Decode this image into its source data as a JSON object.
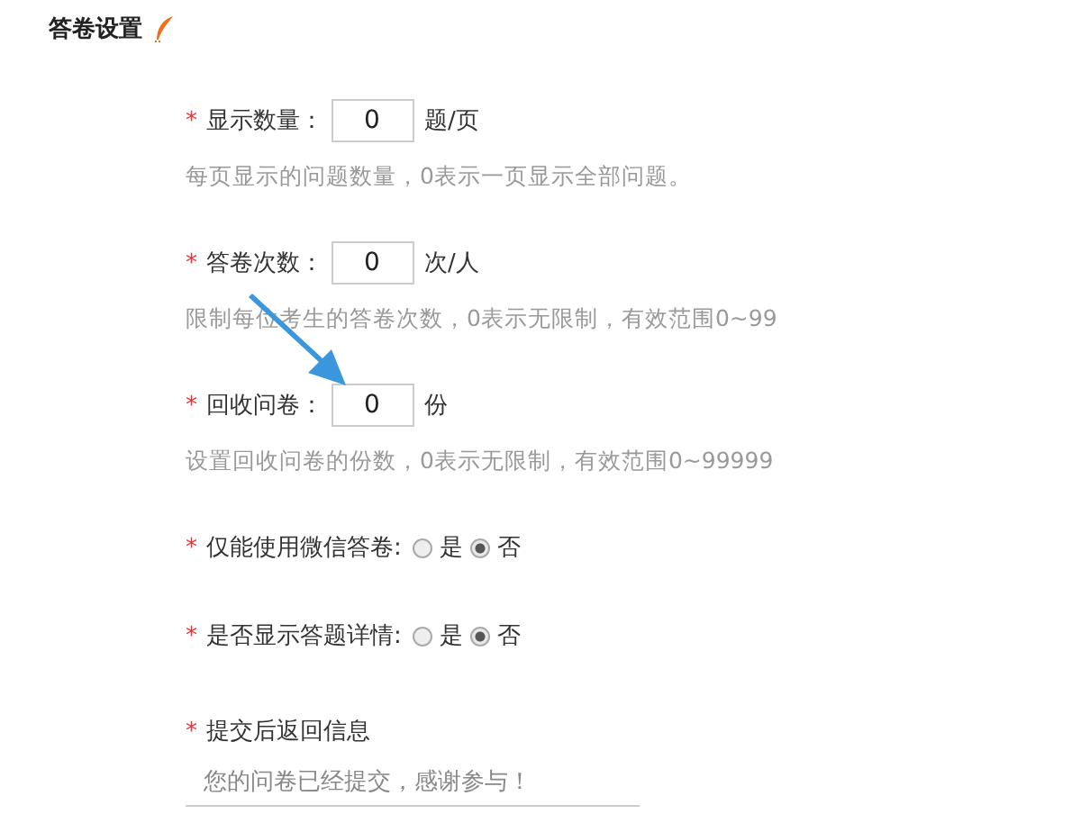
{
  "section": {
    "title": "答卷设置"
  },
  "fields": [
    {
      "kind": "number",
      "mark": "*",
      "label": "显示数量：",
      "value": "0",
      "unit": "题/页",
      "hint": "每页显示的问题数量，0表示一页显示全部问题。"
    },
    {
      "kind": "number",
      "mark": "*",
      "label": "答卷次数：",
      "value": "0",
      "unit": "次/人",
      "hint": "限制每位考生的答卷次数，0表示无限制，有效范围0~99"
    },
    {
      "kind": "number",
      "mark": "*",
      "label": "回收问卷：",
      "value": "0",
      "unit": "份",
      "hint": "设置回收问卷的份数，0表示无限制，有效范围0~99999"
    },
    {
      "kind": "radio",
      "mark": "*",
      "label": "仅能使用微信答卷:",
      "options": [
        {
          "label": "是",
          "selected": false
        },
        {
          "label": "否",
          "selected": true
        }
      ]
    },
    {
      "kind": "radio",
      "mark": "*",
      "label": "是否显示答题详情:",
      "options": [
        {
          "label": "是",
          "selected": false
        },
        {
          "label": "否",
          "selected": true
        }
      ]
    },
    {
      "kind": "text",
      "mark": "*",
      "label": "提交后返回信息",
      "placeholder": "您的问卷已经提交，感谢参与！"
    }
  ]
}
